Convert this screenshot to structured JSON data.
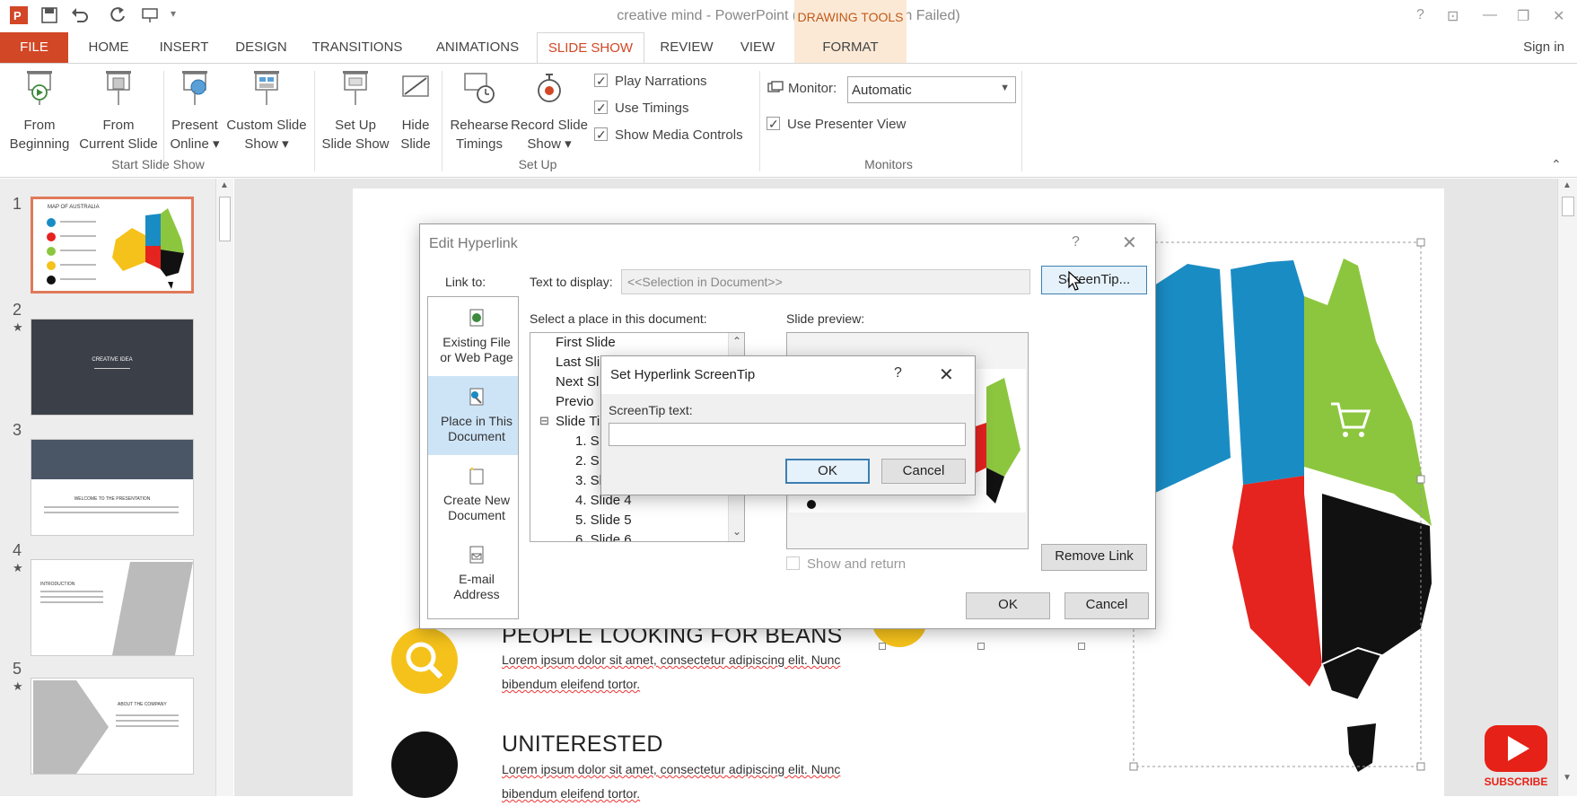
{
  "window": {
    "title": "creative mind - PowerPoint (Product Activation Failed)",
    "contextual_tab_group": "DRAWING TOOLS",
    "help": "?",
    "sign_in": "Sign in"
  },
  "tabs": [
    "FILE",
    "HOME",
    "INSERT",
    "DESIGN",
    "TRANSITIONS",
    "ANIMATIONS",
    "SLIDE SHOW",
    "REVIEW",
    "VIEW",
    "FORMAT"
  ],
  "ribbon": {
    "start": {
      "from_beginning": [
        "From",
        "Beginning"
      ],
      "from_current": [
        "From",
        "Current Slide"
      ],
      "present_online": [
        "Present",
        "Online ▾"
      ],
      "custom_show": [
        "Custom Slide",
        "Show ▾"
      ],
      "label": "Start Slide Show"
    },
    "setup": {
      "setup_show": [
        "Set Up",
        "Slide Show"
      ],
      "hide_slide": [
        "Hide",
        "Slide"
      ],
      "rehearse": [
        "Rehearse",
        "Timings"
      ],
      "record": [
        "Record Slide",
        "Show ▾"
      ],
      "play_narrations": "Play Narrations",
      "use_timings": "Use Timings",
      "show_media_controls": "Show Media Controls",
      "label": "Set Up"
    },
    "monitors": {
      "monitor_label": "Monitor:",
      "monitor_value": "Automatic",
      "presenter_view": "Use Presenter View",
      "label": "Monitors"
    }
  },
  "thumbnails": [
    {
      "num": "1",
      "star": "",
      "text": "MAP OF AUSTRALIA"
    },
    {
      "num": "2",
      "star": "★",
      "text": "CREATIVE IDEA"
    },
    {
      "num": "3",
      "star": "",
      "text": "WELCOME TO THE PRESENTATION"
    },
    {
      "num": "4",
      "star": "★",
      "text": "INTRODUCTION"
    },
    {
      "num": "5",
      "star": "★",
      "text": "ABOUT THE COMPANY"
    }
  ],
  "slide": {
    "item1_heading": "PEOPLE LOOKING FOR BEANS",
    "item1_line1": "Lorem ipsum dolor sit amet, consectetur adipiscing elit. Nunc",
    "item1_line2": "bibendum eleifend tortor.",
    "item2_heading": "UNITERESTED",
    "item2_line1": "Lorem ipsum dolor sit amet, consectetur adipiscing elit. Nunc",
    "item2_line2": "bibendum eleifend tortor."
  },
  "edit_hyperlink": {
    "title": "Edit Hyperlink",
    "help": "?",
    "link_to": "Link to:",
    "text_to_display_label": "Text to display:",
    "text_to_display_value": "<<Selection in Document>>",
    "screentip_button": "ScreenTip...",
    "link_options": [
      [
        "Existing File",
        "or Web Page"
      ],
      [
        "Place in This",
        "Document"
      ],
      [
        "Create New",
        "Document"
      ],
      [
        "E-mail",
        "Address"
      ]
    ],
    "select_place_label": "Select a place in this document:",
    "tree": [
      "First Slide",
      "Last Slide",
      "Next Slide",
      "Previous Slide",
      "Slide Titles",
      "1. Slide 1",
      "2. Slide 2",
      "3. Slide 3",
      "4. Slide 4",
      "5. Slide 5",
      "6. Slide 6"
    ],
    "tree_visible": {
      "last": "Last Sli",
      "next": "Next Sl",
      "prev": "Previo",
      "titles": "Slide Ti",
      "s1": "1. S",
      "s2": "2. S",
      "s3": "3. Slide 3"
    },
    "slide_preview_label": "Slide preview:",
    "show_and_return": "Show and return",
    "remove_link": "Remove Link",
    "ok": "OK",
    "cancel": "Cancel"
  },
  "screentip_dialog": {
    "title": "Set Hyperlink ScreenTip",
    "help": "?",
    "field_label": "ScreenTip text:",
    "field_value": "",
    "ok": "OK",
    "cancel": "Cancel"
  },
  "subscribe": "SUBSCRIBE",
  "colors": {
    "accent": "#d24726",
    "arrow": "#e8532a",
    "map_blue": "#1a8cc4",
    "map_green": "#8cc63f",
    "map_red": "#e5231f",
    "map_yellow": "#f5c21b",
    "youtube_red": "#e62117"
  }
}
